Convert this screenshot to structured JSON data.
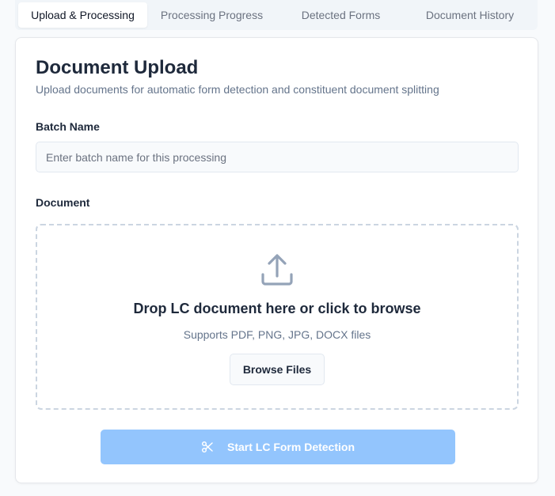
{
  "tabs": [
    {
      "label": "Upload & Processing",
      "active": true
    },
    {
      "label": "Processing Progress",
      "active": false
    },
    {
      "label": "Detected Forms",
      "active": false
    },
    {
      "label": "Document History",
      "active": false
    }
  ],
  "card": {
    "title": "Document Upload",
    "subtitle": "Upload documents for automatic form detection and constituent document splitting"
  },
  "batch": {
    "label": "Batch Name",
    "value": "",
    "placeholder": "Enter batch name for this processing"
  },
  "document": {
    "label": "Document",
    "dropzone_title": "Drop LC document here or click to browse",
    "dropzone_sub": "Supports PDF, PNG, JPG, DOCX files",
    "browse_label": "Browse Files",
    "icon": "upload-icon"
  },
  "start_button": {
    "label": "Start LC Form Detection",
    "icon": "scissors-icon",
    "disabled": true
  },
  "colors": {
    "accent_disabled": "#93c5fd",
    "tab_bar": "#f1f5f9",
    "dropzone_border": "#cbd5e1"
  }
}
